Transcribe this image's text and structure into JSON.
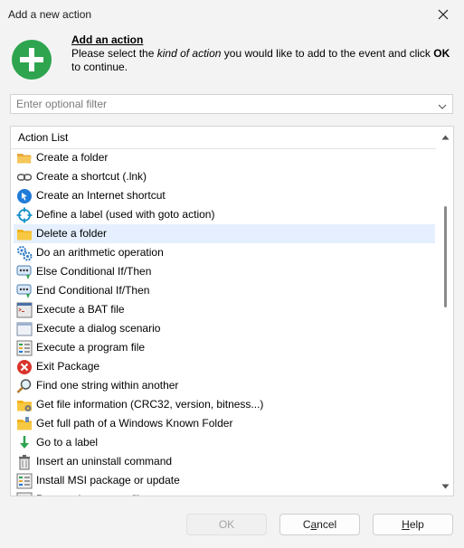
{
  "window": {
    "title": "Add a new action"
  },
  "header": {
    "title": "Add an action",
    "desc_1": "Please select the ",
    "desc_em": "kind of action",
    "desc_2": " you would like to add to the event and click ",
    "desc_bold": "OK",
    "desc_3": " to continue."
  },
  "filter": {
    "placeholder": "Enter optional filter"
  },
  "list": {
    "header": "Action List",
    "selected_index": 4,
    "items": [
      {
        "label": "Create a folder",
        "icon": "folder-open-icon"
      },
      {
        "label": "Create a shortcut (.lnk)",
        "icon": "link-icon"
      },
      {
        "label": "Create an Internet shortcut",
        "icon": "internet-shortcut-icon"
      },
      {
        "label": "Define a label (used with goto action)",
        "icon": "crosshair-icon"
      },
      {
        "label": "Delete a folder",
        "icon": "folder-delete-icon"
      },
      {
        "label": "Do an arithmetic operation",
        "icon": "gears-icon"
      },
      {
        "label": "Else Conditional If/Then",
        "icon": "conditional-icon"
      },
      {
        "label": "End Conditional If/Then",
        "icon": "conditional-icon"
      },
      {
        "label": "Execute a BAT file",
        "icon": "bat-file-icon"
      },
      {
        "label": "Execute a dialog scenario",
        "icon": "dialog-window-icon"
      },
      {
        "label": "Execute a program file",
        "icon": "program-file-icon"
      },
      {
        "label": "Exit Package",
        "icon": "exit-icon"
      },
      {
        "label": "Find one string within another",
        "icon": "magnifier-icon"
      },
      {
        "label": "Get file information (CRC32, version, bitness...)",
        "icon": "file-info-icon"
      },
      {
        "label": "Get full path of a Windows Known Folder",
        "icon": "known-folder-icon"
      },
      {
        "label": "Go to a label",
        "icon": "down-arrow-icon"
      },
      {
        "label": "Insert an uninstall command",
        "icon": "uninstall-icon"
      },
      {
        "label": "Install MSI package or update",
        "icon": "msi-icon"
      },
      {
        "label": "Process images on file",
        "icon": "images-icon"
      }
    ]
  },
  "buttons": {
    "ok": "OK",
    "cancel_pre": "C",
    "cancel_mn": "a",
    "cancel_post": "ncel",
    "help_pre": "",
    "help_mn": "H",
    "help_post": "elp"
  },
  "colors": {
    "add_icon": "#2ea44f",
    "selection": "#e5efff",
    "exit_icon": "#d9342b",
    "link_blue": "#1e7bd8"
  }
}
